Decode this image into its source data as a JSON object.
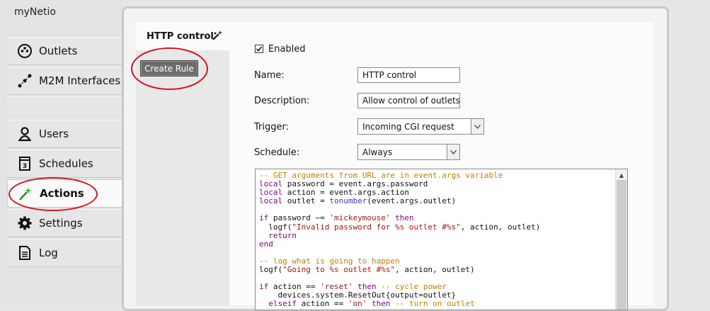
{
  "app": {
    "title": "myNetio"
  },
  "sidebar": {
    "items": [
      {
        "label": "Outlets",
        "icon": "outlet-icon"
      },
      {
        "label": "M2M Interfaces",
        "icon": "m2m-icon"
      },
      {
        "label": "Users",
        "icon": "user-icon"
      },
      {
        "label": "Schedules",
        "icon": "calendar-icon"
      },
      {
        "label": "Actions",
        "icon": "magic-wand-icon",
        "active": true
      },
      {
        "label": "Settings",
        "icon": "gear-icon"
      },
      {
        "label": "Log",
        "icon": "document-icon"
      }
    ]
  },
  "rules": {
    "selected_name": "HTTP control",
    "create_button": "Create Rule"
  },
  "form": {
    "enabled_label": "Enabled",
    "enabled": true,
    "name_label": "Name:",
    "name_value": "HTTP control",
    "description_label": "Description:",
    "description_value": "Allow control of outlets",
    "trigger_label": "Trigger:",
    "trigger_value": "Incoming CGI request",
    "schedule_label": "Schedule:",
    "schedule_value": "Always",
    "code_lines": [
      "-- GET arguments from URL are in event.args variable",
      "local password = event.args.password",
      "local action = event.args.action",
      "local outlet = tonumber(event.args.outlet)",
      "",
      "if password ~= 'mickeymouse' then",
      "  logf(\"Invalid password for %s outlet #%s\", action, outlet)",
      "  return",
      "end",
      "",
      "-- log what is going to happen",
      "logf(\"Going to %s outlet #%s\", action, outlet)",
      "",
      "if action == 'reset' then -- cycle power",
      "    devices.system.ResetOut{output=outlet}",
      "  elseif action == 'on' then -- turn on outlet"
    ]
  },
  "colors": {
    "highlight_oval": "#d4121c",
    "comment": "#c08000",
    "keyword": "#7f007f",
    "string": "#a31515"
  }
}
